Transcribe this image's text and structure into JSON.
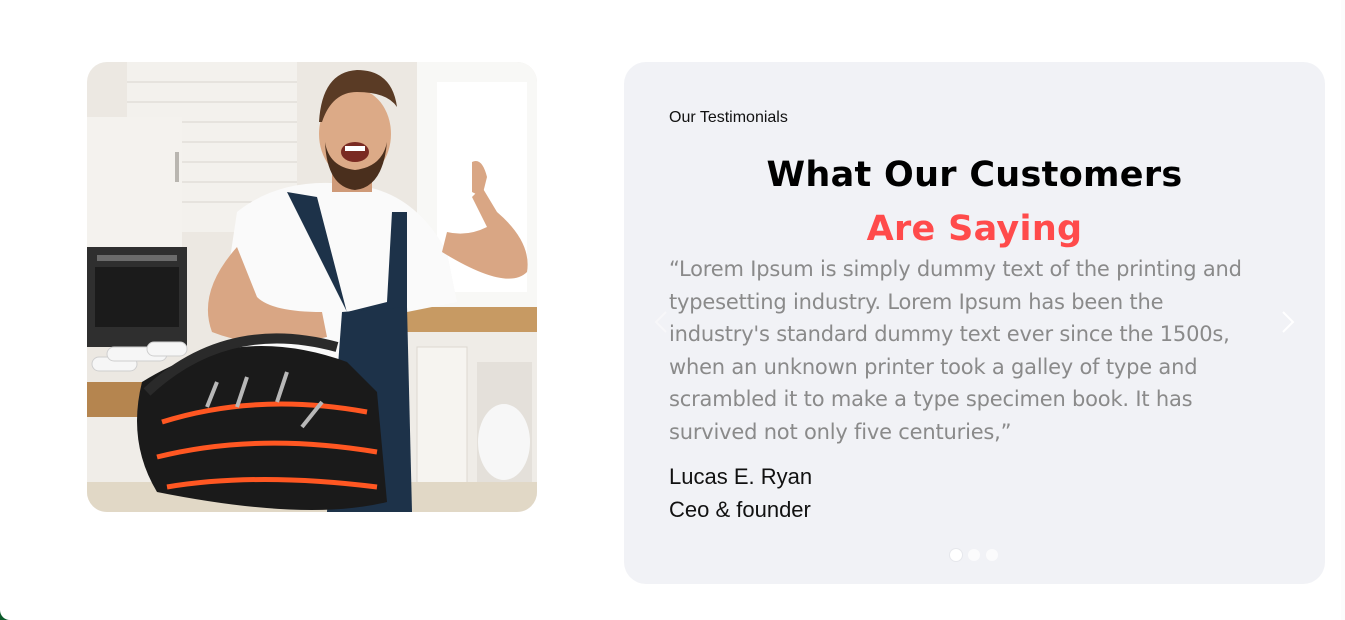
{
  "photo": {
    "alt": "Smiling plumber holding a tool bag in a kitchen"
  },
  "testimonials": {
    "eyebrow": "Our Testimonials",
    "heading_line1": "What Our Customers",
    "heading_line2": "Are Saying",
    "quote": "“Lorem Ipsum is simply dummy text of the printing and typesetting industry. Lorem Ipsum has been the industry's standard dummy text ever since the 1500s, when an unknown printer took a galley of type and scrambled it to make a type specimen book. It has survived not only five centuries,”",
    "author_name": "Lucas E. Ryan",
    "author_role": "Ceo & founder",
    "accent_color": "#ff4b4b",
    "prev_icon": "chevron-left-icon",
    "next_icon": "chevron-right-icon",
    "pagination": {
      "total": 3,
      "active": 1
    }
  }
}
